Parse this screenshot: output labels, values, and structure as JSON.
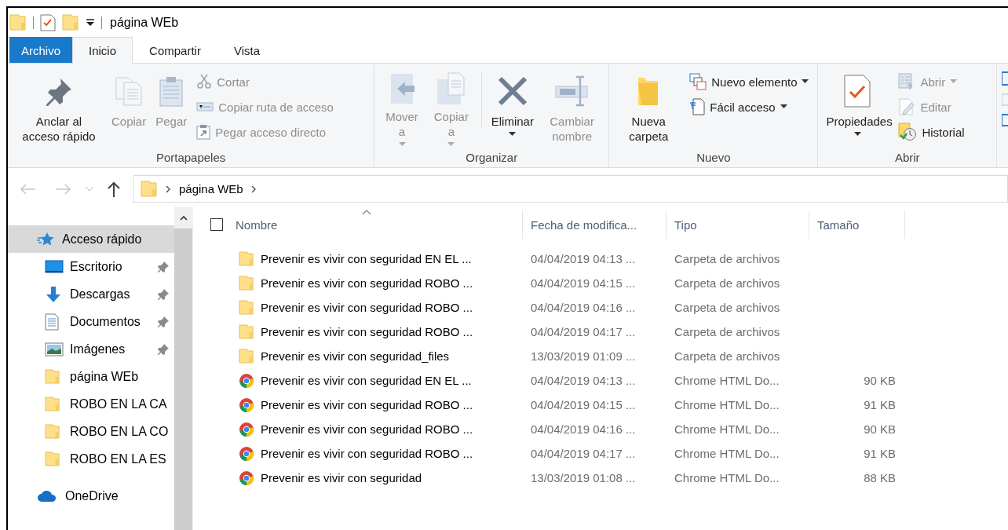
{
  "window": {
    "title": "página WEb"
  },
  "tabs": [
    {
      "label": "Archivo",
      "kind": "file",
      "selected": false
    },
    {
      "label": "Inicio",
      "kind": "tab",
      "selected": true
    },
    {
      "label": "Compartir",
      "kind": "tab",
      "selected": false
    },
    {
      "label": "Vista",
      "kind": "tab",
      "selected": false
    }
  ],
  "ribbon": {
    "groups": [
      {
        "label": "Portapapeles",
        "items": [
          {
            "kind": "large",
            "label": "Anclar al acceso rápido",
            "disabled": false
          },
          {
            "kind": "large",
            "label": "Copiar",
            "disabled": true
          },
          {
            "kind": "large",
            "label": "Pegar",
            "disabled": true
          },
          {
            "kind": "small",
            "label": "Cortar",
            "disabled": true
          },
          {
            "kind": "small",
            "label": "Copiar ruta de acceso",
            "disabled": true
          },
          {
            "kind": "small",
            "label": "Pegar acceso directo",
            "disabled": true
          }
        ]
      },
      {
        "label": "Organizar",
        "items": [
          {
            "kind": "large",
            "label": "Mover a",
            "disabled": true,
            "dropdown": true
          },
          {
            "kind": "large",
            "label": "Copiar a",
            "disabled": true,
            "dropdown": true
          },
          {
            "kind": "separator"
          },
          {
            "kind": "large",
            "label": "Eliminar",
            "disabled": false,
            "dropdown": true
          },
          {
            "kind": "large",
            "label": "Cambiar nombre",
            "disabled": true
          }
        ]
      },
      {
        "label": "Nuevo",
        "items": [
          {
            "kind": "large",
            "label": "Nueva carpeta",
            "disabled": false
          },
          {
            "kind": "small",
            "label": "Nuevo elemento",
            "disabled": false,
            "dropdown": true
          },
          {
            "kind": "small",
            "label": "Fácil acceso",
            "disabled": false,
            "dropdown": true
          }
        ]
      },
      {
        "label": "Abrir",
        "items": [
          {
            "kind": "large",
            "label": "Propiedades",
            "disabled": false,
            "dropdown": true
          },
          {
            "kind": "small",
            "label": "Abrir",
            "disabled": true,
            "dropdown": true
          },
          {
            "kind": "small",
            "label": "Editar",
            "disabled": true
          },
          {
            "kind": "small",
            "label": "Historial",
            "disabled": false
          }
        ]
      }
    ]
  },
  "address": {
    "path": [
      "página WEb"
    ]
  },
  "sidebar": {
    "items": [
      {
        "label": "Acceso rápido",
        "kind": "quick",
        "selected": true,
        "pinned": false,
        "children": [
          {
            "label": "Escritorio",
            "kind": "desktop",
            "selected": false,
            "pinned": true
          },
          {
            "label": "Descargas",
            "kind": "downloads",
            "selected": false,
            "pinned": true
          },
          {
            "label": "Documentos",
            "kind": "documents",
            "selected": false,
            "pinned": true
          },
          {
            "label": "Imágenes",
            "kind": "pictures",
            "selected": false,
            "pinned": true
          },
          {
            "label": "página WEb",
            "kind": "folder",
            "selected": false,
            "pinned": false
          },
          {
            "label": "ROBO EN LA CA",
            "kind": "folder",
            "selected": false,
            "pinned": false
          },
          {
            "label": "ROBO EN LA CO",
            "kind": "folder",
            "selected": false,
            "pinned": false
          },
          {
            "label": "ROBO EN LA ES",
            "kind": "folder",
            "selected": false,
            "pinned": false
          }
        ]
      },
      {
        "label": "OneDrive",
        "kind": "onedrive",
        "selected": false,
        "pinned": false
      }
    ]
  },
  "table": {
    "select_all": {
      "checked": false
    },
    "columns": [
      "Nombre",
      "Fecha de modifica...",
      "Tipo",
      "Tamaño"
    ],
    "rows": [
      {
        "kind": "folder",
        "name": "Prevenir es vivir con seguridad EN EL ...",
        "date": "04/04/2019 04:13 ...",
        "type": "Carpeta de archivos"
      },
      {
        "kind": "folder",
        "name": "Prevenir es vivir con seguridad ROBO ...",
        "date": "04/04/2019 04:15 ...",
        "type": "Carpeta de archivos"
      },
      {
        "kind": "folder",
        "name": "Prevenir es vivir con seguridad ROBO ...",
        "date": "04/04/2019 04:16 ...",
        "type": "Carpeta de archivos"
      },
      {
        "kind": "folder",
        "name": "Prevenir es vivir con seguridad ROBO ...",
        "date": "04/04/2019 04:17 ...",
        "type": "Carpeta de archivos"
      },
      {
        "kind": "folder",
        "name": "Prevenir es vivir con seguridad_files",
        "date": "13/03/2019 01:09 ...",
        "type": "Carpeta de archivos"
      },
      {
        "kind": "chrome",
        "name": "Prevenir es vivir con seguridad EN EL ...",
        "date": "04/04/2019 04:13 ...",
        "type": "Chrome HTML Do...",
        "size": "90 KB"
      },
      {
        "kind": "chrome",
        "name": "Prevenir es vivir con seguridad ROBO ...",
        "date": "04/04/2019 04:15 ...",
        "type": "Chrome HTML Do...",
        "size": "91 KB"
      },
      {
        "kind": "chrome",
        "name": "Prevenir es vivir con seguridad ROBO ...",
        "date": "04/04/2019 04:16 ...",
        "type": "Chrome HTML Do...",
        "size": "90 KB"
      },
      {
        "kind": "chrome",
        "name": "Prevenir es vivir con seguridad ROBO ...",
        "date": "04/04/2019 04:17 ...",
        "type": "Chrome HTML Do...",
        "size": "91 KB"
      },
      {
        "kind": "chrome",
        "name": "Prevenir es vivir con seguridad",
        "date": "13/03/2019 01:08 ...",
        "type": "Chrome HTML Do...",
        "size": "88 KB"
      }
    ]
  }
}
